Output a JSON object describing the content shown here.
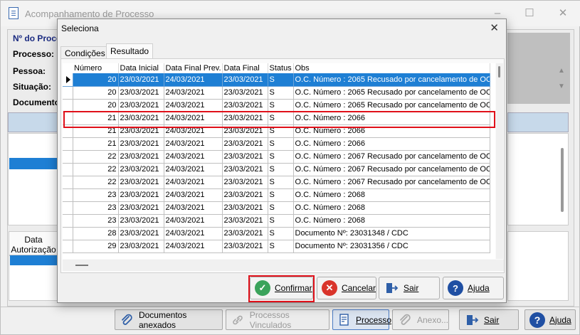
{
  "background_window": {
    "title": "Acompanhamento de Processo",
    "labels": {
      "numero": "Nº do Proce",
      "processo": "Processo:",
      "pessoa": "Pessoa:",
      "situacao": "Situação:",
      "documento": "Documento"
    },
    "grid_header": [
      "Data",
      "Autorização"
    ],
    "toolbar": {
      "documentos_anexados": "Documentos anexados",
      "processos_vinculados": "Processos Vinculados",
      "processo": "Processo",
      "anexo": "Anexo...",
      "sair": "Sair",
      "ajuda": "Ajuda"
    }
  },
  "dialog": {
    "title": "Seleciona",
    "close_glyph": "✕",
    "tabs": [
      "Condições",
      "Resultado"
    ],
    "active_tab": "Resultado",
    "columns": [
      "Número",
      "Data Inicial",
      "Data Final Prev.",
      "Data Final",
      "Status",
      "Obs"
    ],
    "rows": [
      {
        "numero": "20",
        "data_inicial": "23/03/2021",
        "data_final_prev": "24/03/2021",
        "data_final": "23/03/2021",
        "status": "S",
        "obs": "O.C. Número : 2065 Recusado por cancelamento de OC"
      },
      {
        "numero": "20",
        "data_inicial": "23/03/2021",
        "data_final_prev": "24/03/2021",
        "data_final": "23/03/2021",
        "status": "S",
        "obs": "O.C. Número : 2065 Recusado por cancelamento de OC"
      },
      {
        "numero": "20",
        "data_inicial": "23/03/2021",
        "data_final_prev": "24/03/2021",
        "data_final": "23/03/2021",
        "status": "S",
        "obs": "O.C. Número : 2065 Recusado por cancelamento de OC"
      },
      {
        "numero": "21",
        "data_inicial": "23/03/2021",
        "data_final_prev": "24/03/2021",
        "data_final": "23/03/2021",
        "status": "S",
        "obs": "O.C. Número : 2066"
      },
      {
        "numero": "21",
        "data_inicial": "23/03/2021",
        "data_final_prev": "24/03/2021",
        "data_final": "23/03/2021",
        "status": "S",
        "obs": "O.C. Número : 2066"
      },
      {
        "numero": "21",
        "data_inicial": "23/03/2021",
        "data_final_prev": "24/03/2021",
        "data_final": "23/03/2021",
        "status": "S",
        "obs": "O.C. Número : 2066"
      },
      {
        "numero": "22",
        "data_inicial": "23/03/2021",
        "data_final_prev": "24/03/2021",
        "data_final": "23/03/2021",
        "status": "S",
        "obs": "O.C. Número : 2067 Recusado por cancelamento de OC"
      },
      {
        "numero": "22",
        "data_inicial": "23/03/2021",
        "data_final_prev": "24/03/2021",
        "data_final": "23/03/2021",
        "status": "S",
        "obs": "O.C. Número : 2067 Recusado por cancelamento de OC"
      },
      {
        "numero": "22",
        "data_inicial": "23/03/2021",
        "data_final_prev": "24/03/2021",
        "data_final": "23/03/2021",
        "status": "S",
        "obs": "O.C. Número : 2067 Recusado por cancelamento de OC"
      },
      {
        "numero": "23",
        "data_inicial": "23/03/2021",
        "data_final_prev": "24/03/2021",
        "data_final": "23/03/2021",
        "status": "S",
        "obs": "O.C. Número : 2068"
      },
      {
        "numero": "23",
        "data_inicial": "23/03/2021",
        "data_final_prev": "24/03/2021",
        "data_final": "23/03/2021",
        "status": "S",
        "obs": "O.C. Número : 2068"
      },
      {
        "numero": "23",
        "data_inicial": "23/03/2021",
        "data_final_prev": "24/03/2021",
        "data_final": "23/03/2021",
        "status": "S",
        "obs": "O.C. Número : 2068"
      },
      {
        "numero": "28",
        "data_inicial": "23/03/2021",
        "data_final_prev": "24/03/2021",
        "data_final": "23/03/2021",
        "status": "S",
        "obs": "Documento Nº: 23031348 / CDC"
      },
      {
        "numero": "29",
        "data_inicial": "23/03/2021",
        "data_final_prev": "24/03/2021",
        "data_final": "23/03/2021",
        "status": "S",
        "obs": "Documento Nº: 23031356 / CDC"
      }
    ],
    "selected_row": 0,
    "buttons": {
      "confirmar": "Confirmar",
      "cancelar": "Cancelar",
      "sair": "Sair",
      "ajuda": "Ajuda"
    }
  },
  "colors": {
    "selection": "#1e7fd4",
    "highlight_border": "#e0101a",
    "confirm_icon": "#3aa35b",
    "cancel_icon": "#d9342b",
    "help_icon": "#1f4fa3"
  }
}
